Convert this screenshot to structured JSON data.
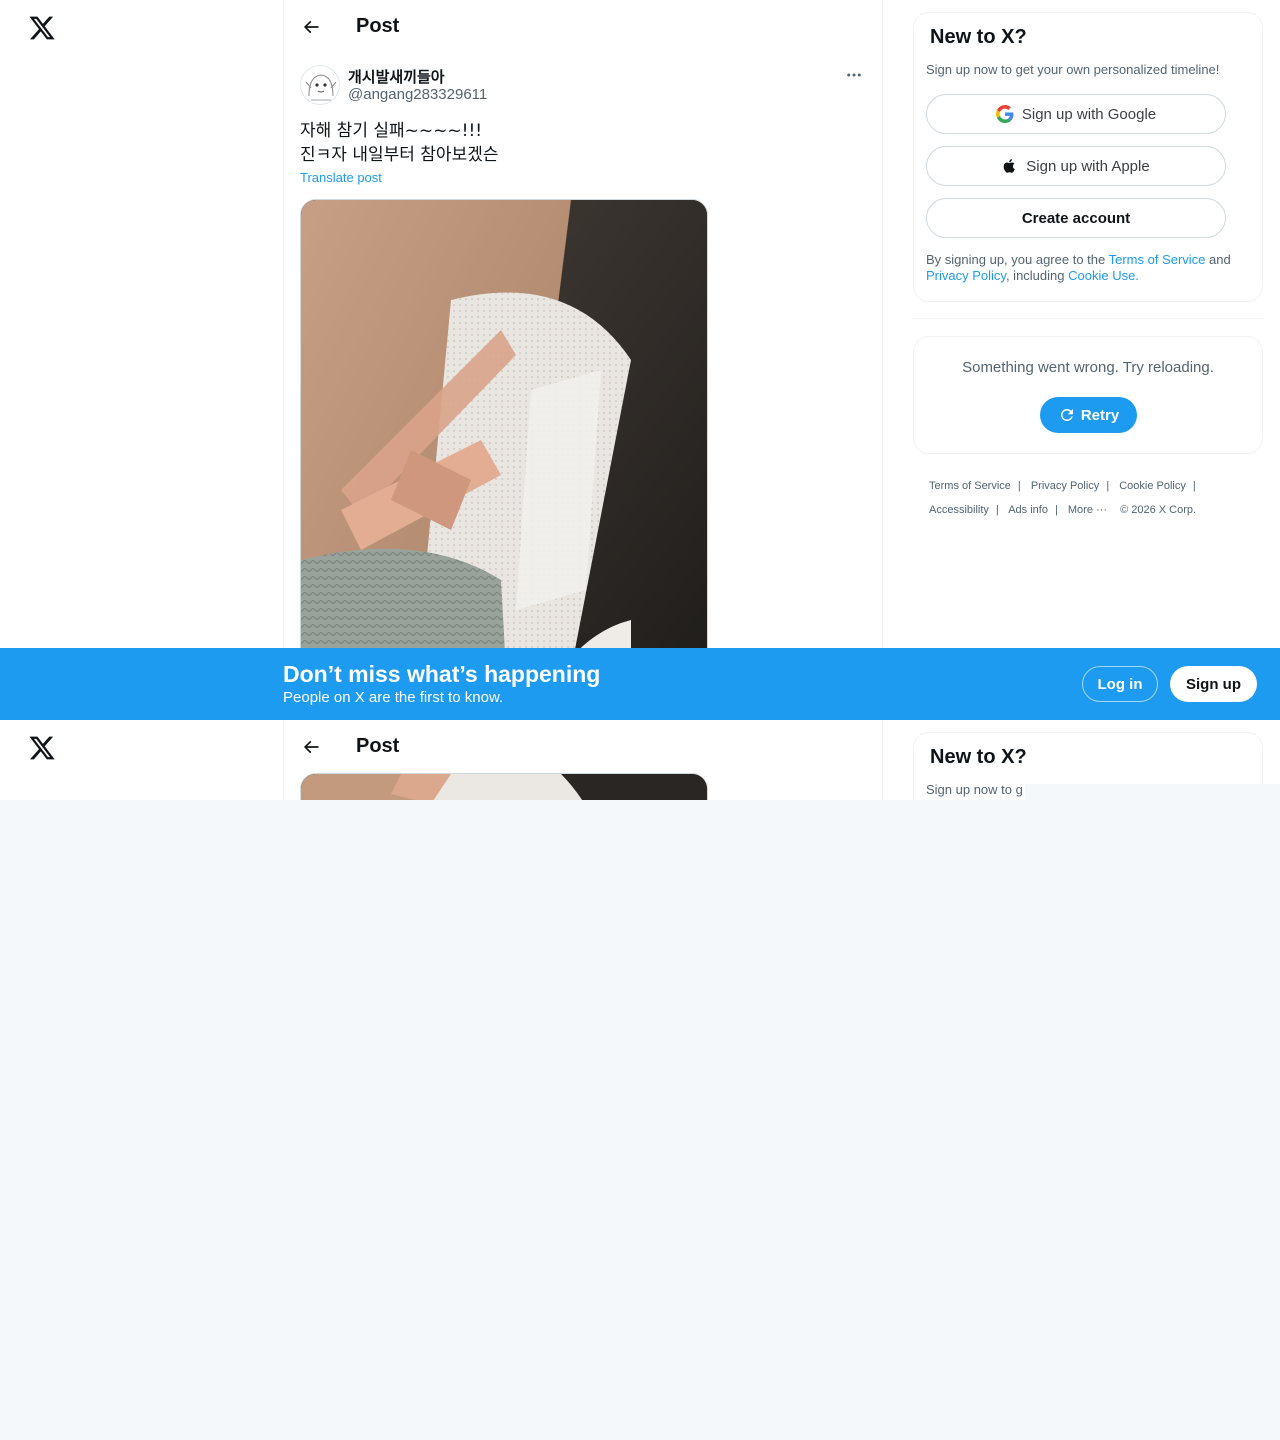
{
  "header": {
    "title": "Post"
  },
  "post": {
    "display_name": "개시발새끼들아",
    "handle": "@angang283329611",
    "text_line1": "자해 참기 실패~~~~!!!",
    "text_line2": "진ㅋ자 내일부터 참아보겠슨",
    "translate_label": "Translate post"
  },
  "signup_card": {
    "title": "New to X?",
    "subtitle": "Sign up now to get your own personalized timeline!",
    "google_label": "Sign up with Google",
    "apple_label": "Sign up with Apple",
    "create_label": "Create account",
    "legal_prefix": "By signing up, you agree to the ",
    "terms_link": "Terms of Service",
    "and": " and ",
    "privacy_link": "Privacy Policy",
    "including": ", including ",
    "cookie_link": "Cookie Use."
  },
  "error_card": {
    "message": "Something went wrong. Try reloading.",
    "retry_label": "Retry"
  },
  "footer": {
    "terms": "Terms of Service",
    "privacy": "Privacy Policy",
    "cookie": "Cookie Policy",
    "accessibility": "Accessibility",
    "ads": "Ads info",
    "more": "More ···",
    "copyright": "© 2026 X Corp."
  },
  "banner": {
    "title": "Don’t miss what’s happening",
    "subtitle": "People on X are the first to know.",
    "login_label": "Log in",
    "signup_label": "Sign up"
  },
  "second_view": {
    "header_title": "Post",
    "card_title": "New to X?",
    "card_sub_partial": "Sign up now to g"
  },
  "colors": {
    "accent": "#1d9bf0",
    "text_primary": "#0f1419",
    "text_secondary": "#536471",
    "border": "#eff3f4",
    "page_bg": "#f5f8fa"
  },
  "icons": {
    "logo": "x-logo-icon",
    "back": "arrow-left-icon",
    "more": "more-horizontal-icon",
    "google": "google-g-icon",
    "apple": "apple-icon",
    "retry": "refresh-icon"
  }
}
